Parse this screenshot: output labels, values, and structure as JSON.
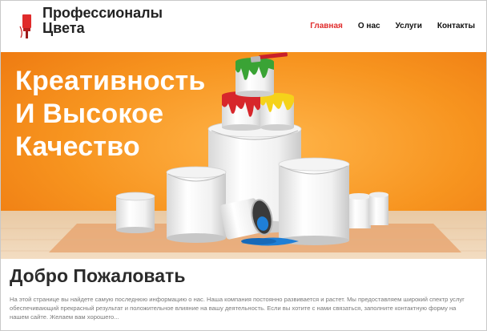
{
  "header": {
    "brand_line1": "Профессионалы",
    "brand_line2": "Цвета",
    "logo_icon": "paint-brush-icon",
    "nav": [
      {
        "label": "Главная",
        "active": true
      },
      {
        "label": "О нас",
        "active": false
      },
      {
        "label": "Услуги",
        "active": false
      },
      {
        "label": "Контакты",
        "active": false
      }
    ]
  },
  "hero": {
    "title_line1": "Креативность",
    "title_line2": "И Высокое",
    "title_line3": "Качество"
  },
  "welcome": {
    "title": "Добро Пожаловать",
    "text": "На этой странице вы найдете самую последнюю информацию о нас. Наша компания постоянно развивается и растет. Мы предоставляем широкий спектр услуг обеспечивающий прекрасный результат и положительное влияние на вашу деятельность. Если вы хотите с нами связаться, заполните контактную форму на нашем сайте. Желаем вам хорошего..."
  },
  "colors": {
    "accent": "#e02b2b",
    "hero_bg": "#f58a1c",
    "paint_green": "#3aa335",
    "paint_red": "#d7262b",
    "paint_yellow": "#f5d21a",
    "paint_blue": "#1f7fd6"
  }
}
